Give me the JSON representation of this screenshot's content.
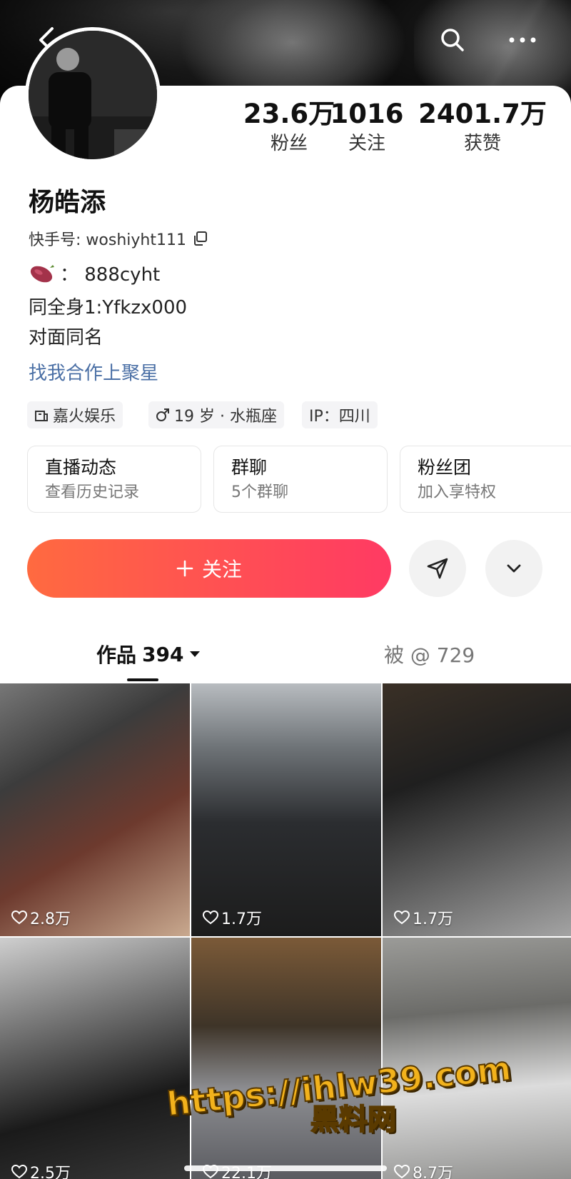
{
  "profile": {
    "name": "杨皓添",
    "kuaishou_id_label": "快手号: woshiyht111",
    "bio_line1": "：  888cyht",
    "bio_line2": "同全身1:Yfkzx000",
    "bio_line3": "对面同名",
    "cooperate_link": "找我合作上聚星"
  },
  "stats": [
    {
      "value": "23.6万",
      "label": "粉丝"
    },
    {
      "value": "1016",
      "label": "关注"
    },
    {
      "value": "2401.7万",
      "label": "获赞"
    }
  ],
  "tags": {
    "agency": "嘉火娱乐",
    "age_sign": "19 岁 · 水瓶座",
    "ip": "IP：四川"
  },
  "features": [
    {
      "title": "直播动态",
      "subtitle": "查看历史记录"
    },
    {
      "title": "群聊",
      "subtitle": "5个群聊"
    },
    {
      "title": "粉丝团",
      "subtitle": "加入享特权"
    }
  ],
  "actions": {
    "follow_label": "关注",
    "follow_accent_start": "#ff6a40",
    "follow_accent_end": "#ff3a63"
  },
  "tabs": {
    "works_label": "作品",
    "works_count": "394",
    "mentioned_label": "被 @ 729"
  },
  "videos": [
    {
      "likes": "2.8万"
    },
    {
      "likes": "1.7万"
    },
    {
      "likes": "1.7万"
    },
    {
      "likes": "2.5万"
    },
    {
      "likes": "22.1万"
    },
    {
      "likes": "8.7万"
    }
  ],
  "watermark": {
    "url": "https://ihlw39.com",
    "name": "黑料网"
  }
}
